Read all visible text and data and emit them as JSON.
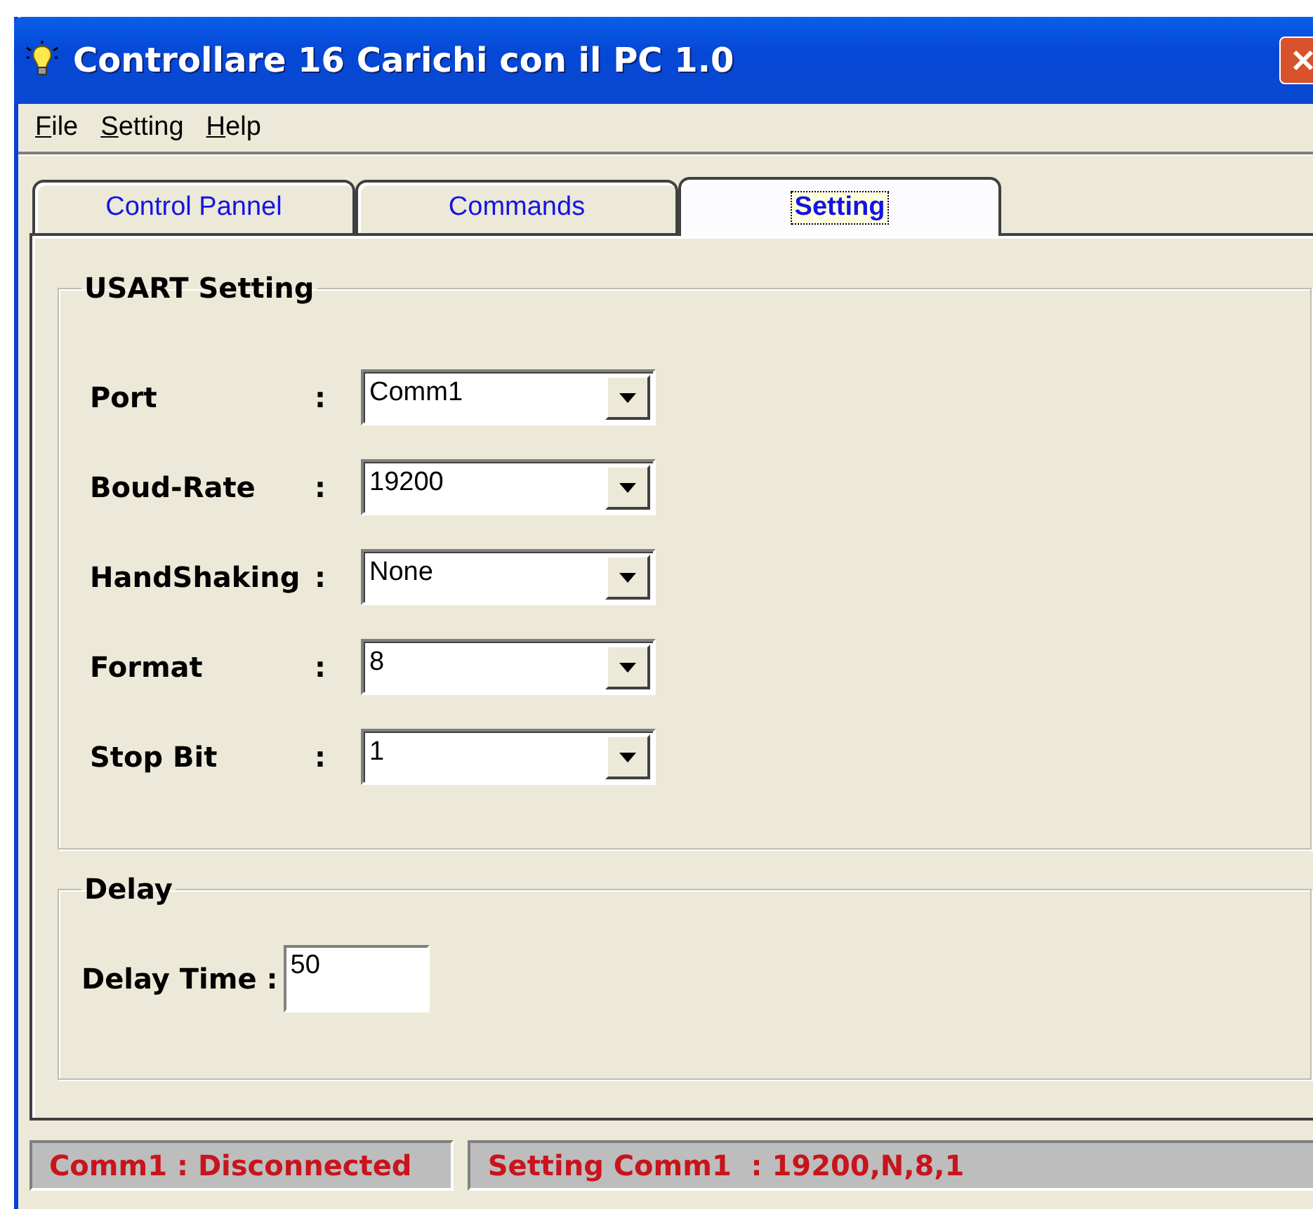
{
  "window": {
    "title": "Controllare 16 Carichi con il PC 1.0"
  },
  "menu": [
    {
      "label": "File"
    },
    {
      "label": "Setting"
    },
    {
      "label": "Help"
    }
  ],
  "tabs": [
    {
      "label": "Control Pannel",
      "selected": false
    },
    {
      "label": "Commands",
      "selected": false
    },
    {
      "label": "Setting",
      "selected": true
    }
  ],
  "usart": {
    "title": "USART Setting",
    "fields": [
      {
        "label": "Port",
        "separator": ":",
        "value": "Comm1"
      },
      {
        "label": "Boud-Rate",
        "separator": ":",
        "value": "19200"
      },
      {
        "label": "HandShaking",
        "separator": ":",
        "value": "None"
      },
      {
        "label": "Format",
        "separator": ":",
        "value": "8"
      },
      {
        "label": "Stop Bit",
        "separator": ":",
        "value": "1"
      }
    ]
  },
  "delay": {
    "title": "Delay",
    "label": "Delay Time :",
    "value": "50"
  },
  "status_bar": [
    "Comm1 : Disconnected",
    "Setting Comm1  : 19200,N,8,1"
  ]
}
